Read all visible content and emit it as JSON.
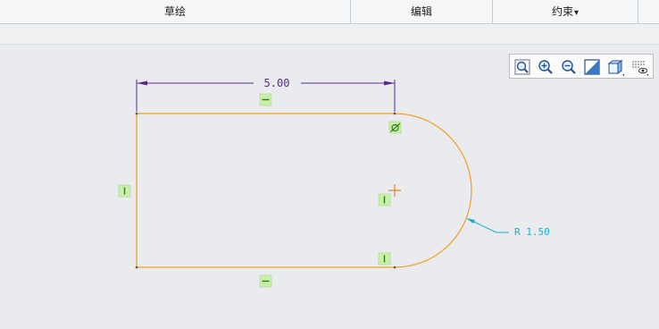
{
  "menubar": {
    "items": [
      {
        "label": "草绘"
      },
      {
        "label": "编辑"
      },
      {
        "label": "约束"
      }
    ],
    "dropdown_arrow": "▾"
  },
  "view_toolbar": {
    "buttons": [
      "zoom-fit-icon",
      "zoom-in-icon",
      "zoom-out-icon",
      "repaint-icon",
      "display-style-icon",
      "sketch-display-icon"
    ]
  },
  "sketch": {
    "dimension_length": "5.00",
    "dimension_radius": "R 1.50",
    "colors": {
      "geometry": "#f0a020",
      "dimension": "#5a2a8a",
      "radius_dimension": "#1aaed0",
      "constraint_bg": "#c8f0a8",
      "constraint_fg": "#2e7d1f",
      "center_mark": "#e07000"
    }
  }
}
